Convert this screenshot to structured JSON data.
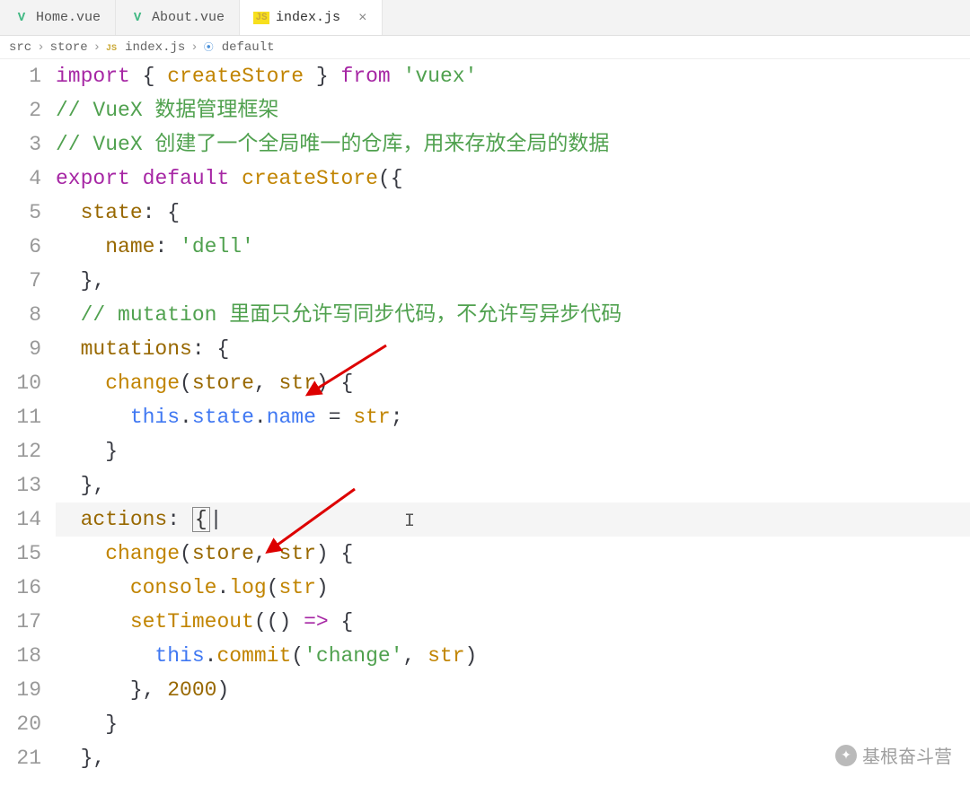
{
  "tabs": [
    {
      "label": "Home.vue",
      "type": "vue",
      "active": false
    },
    {
      "label": "About.vue",
      "type": "vue",
      "active": false
    },
    {
      "label": "index.js",
      "type": "js",
      "active": true
    }
  ],
  "breadcrumb": {
    "parts": [
      "src",
      "store",
      "index.js",
      "default"
    ]
  },
  "code": {
    "lines": [
      {
        "n": 1,
        "tokens": [
          [
            "kw",
            "import"
          ],
          [
            "punct",
            " { "
          ],
          [
            "ident",
            "createStore"
          ],
          [
            "punct",
            " } "
          ],
          [
            "kw",
            "from"
          ],
          [
            "punct",
            " "
          ],
          [
            "str",
            "'vuex'"
          ]
        ]
      },
      {
        "n": 2,
        "tokens": [
          [
            "com",
            "// VueX 数据管理框架"
          ]
        ]
      },
      {
        "n": 3,
        "tokens": [
          [
            "com",
            "// VueX 创建了一个全局唯一的仓库，用来存放全局的数据"
          ]
        ]
      },
      {
        "n": 4,
        "tokens": [
          [
            "kw",
            "export"
          ],
          [
            "punct",
            " "
          ],
          [
            "kw",
            "default"
          ],
          [
            "punct",
            " "
          ],
          [
            "fn",
            "createStore"
          ],
          [
            "punct",
            "({"
          ]
        ]
      },
      {
        "n": 5,
        "tokens": [
          [
            "punct",
            "  "
          ],
          [
            "prop",
            "state"
          ],
          [
            "punct",
            ": {"
          ]
        ]
      },
      {
        "n": 6,
        "tokens": [
          [
            "punct",
            "    "
          ],
          [
            "prop",
            "name"
          ],
          [
            "punct",
            ": "
          ],
          [
            "str",
            "'dell'"
          ]
        ]
      },
      {
        "n": 7,
        "tokens": [
          [
            "punct",
            "  },"
          ]
        ]
      },
      {
        "n": 8,
        "tokens": [
          [
            "punct",
            "  "
          ],
          [
            "com",
            "// mutation 里面只允许写同步代码，不允许写异步代码"
          ]
        ]
      },
      {
        "n": 9,
        "tokens": [
          [
            "punct",
            "  "
          ],
          [
            "prop",
            "mutations"
          ],
          [
            "punct",
            ": {"
          ]
        ]
      },
      {
        "n": 10,
        "tokens": [
          [
            "punct",
            "    "
          ],
          [
            "fn",
            "change"
          ],
          [
            "punct",
            "("
          ],
          [
            "param",
            "store"
          ],
          [
            "punct",
            ", "
          ],
          [
            "param",
            "str"
          ],
          [
            "punct",
            ") {"
          ]
        ]
      },
      {
        "n": 11,
        "tokens": [
          [
            "punct",
            "      "
          ],
          [
            "this",
            "this"
          ],
          [
            "punct",
            "."
          ],
          [
            "member",
            "state"
          ],
          [
            "punct",
            "."
          ],
          [
            "member",
            "name"
          ],
          [
            "punct",
            " = "
          ],
          [
            "ident",
            "str"
          ],
          [
            "punct",
            ";"
          ]
        ]
      },
      {
        "n": 12,
        "tokens": [
          [
            "punct",
            "    }"
          ]
        ]
      },
      {
        "n": 13,
        "tokens": [
          [
            "punct",
            "  },"
          ]
        ]
      },
      {
        "n": 14,
        "hl": true,
        "tokens": [
          [
            "punct",
            "  "
          ],
          [
            "prop",
            "actions"
          ],
          [
            "punct",
            ": "
          ],
          [
            "boxed",
            "{"
          ],
          [
            "punct",
            "|"
          ]
        ]
      },
      {
        "n": 15,
        "tokens": [
          [
            "punct",
            "    "
          ],
          [
            "fn",
            "change"
          ],
          [
            "punct",
            "("
          ],
          [
            "param",
            "store"
          ],
          [
            "punct",
            ", "
          ],
          [
            "param",
            "str"
          ],
          [
            "punct",
            ") {"
          ]
        ]
      },
      {
        "n": 16,
        "tokens": [
          [
            "punct",
            "      "
          ],
          [
            "ident",
            "console"
          ],
          [
            "punct",
            "."
          ],
          [
            "fn",
            "log"
          ],
          [
            "punct",
            "("
          ],
          [
            "ident",
            "str"
          ],
          [
            "punct",
            ")"
          ]
        ]
      },
      {
        "n": 17,
        "tokens": [
          [
            "punct",
            "      "
          ],
          [
            "fn",
            "setTimeout"
          ],
          [
            "punct",
            "(() "
          ],
          [
            "op",
            "=>"
          ],
          [
            "punct",
            " {"
          ]
        ]
      },
      {
        "n": 18,
        "tokens": [
          [
            "punct",
            "        "
          ],
          [
            "this",
            "this"
          ],
          [
            "punct",
            "."
          ],
          [
            "fn",
            "commit"
          ],
          [
            "punct",
            "("
          ],
          [
            "str",
            "'change'"
          ],
          [
            "punct",
            ", "
          ],
          [
            "ident",
            "str"
          ],
          [
            "punct",
            ")"
          ]
        ]
      },
      {
        "n": 19,
        "tokens": [
          [
            "punct",
            "      }, "
          ],
          [
            "num",
            "2000"
          ],
          [
            "punct",
            ")"
          ]
        ]
      },
      {
        "n": 20,
        "tokens": [
          [
            "punct",
            "    }"
          ]
        ]
      },
      {
        "n": 21,
        "tokens": [
          [
            "punct",
            "  },"
          ]
        ]
      }
    ]
  },
  "watermark": "基根奋斗营"
}
